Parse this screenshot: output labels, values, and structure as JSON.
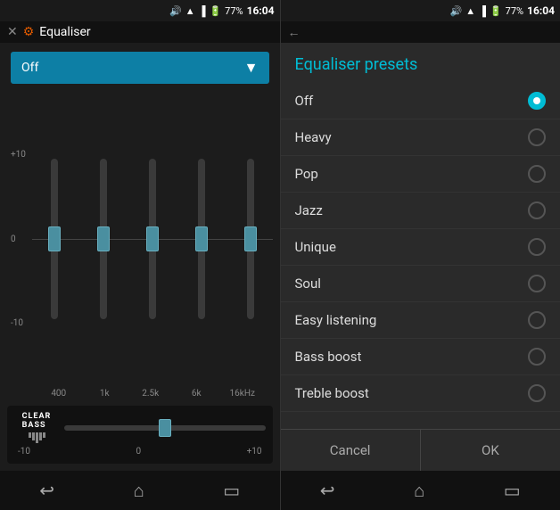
{
  "left": {
    "title": "Equaliser",
    "status_time": "16:04",
    "battery": "77%",
    "dropdown": {
      "label": "Off",
      "arrow": "▼"
    },
    "scale": {
      "top": "+10",
      "zero": "0",
      "bottom": "-10"
    },
    "sliders": [
      {
        "freq": "400",
        "value": 0
      },
      {
        "freq": "1k",
        "value": 0
      },
      {
        "freq": "2.5k",
        "value": 0
      },
      {
        "freq": "6k",
        "value": 0
      },
      {
        "freq": "16kHz",
        "value": 0
      }
    ],
    "clear_bass": {
      "label": "CLEAR",
      "label2": "BASS",
      "min": "-10",
      "zero": "0",
      "max": "+10",
      "value": 0
    },
    "nav": {
      "back": "↩",
      "home": "⌂",
      "recent": "▭"
    }
  },
  "right": {
    "title": "Equaliser presets",
    "status_time": "16:04",
    "battery": "77%",
    "presets": [
      {
        "name": "Off",
        "selected": true
      },
      {
        "name": "Heavy",
        "selected": false
      },
      {
        "name": "Pop",
        "selected": false
      },
      {
        "name": "Jazz",
        "selected": false
      },
      {
        "name": "Unique",
        "selected": false
      },
      {
        "name": "Soul",
        "selected": false
      },
      {
        "name": "Easy listening",
        "selected": false
      },
      {
        "name": "Bass boost",
        "selected": false
      },
      {
        "name": "Treble boost",
        "selected": false
      }
    ],
    "buttons": {
      "cancel": "Cancel",
      "ok": "OK"
    },
    "nav": {
      "back": "↩",
      "home": "⌂",
      "recent": "▭"
    }
  }
}
